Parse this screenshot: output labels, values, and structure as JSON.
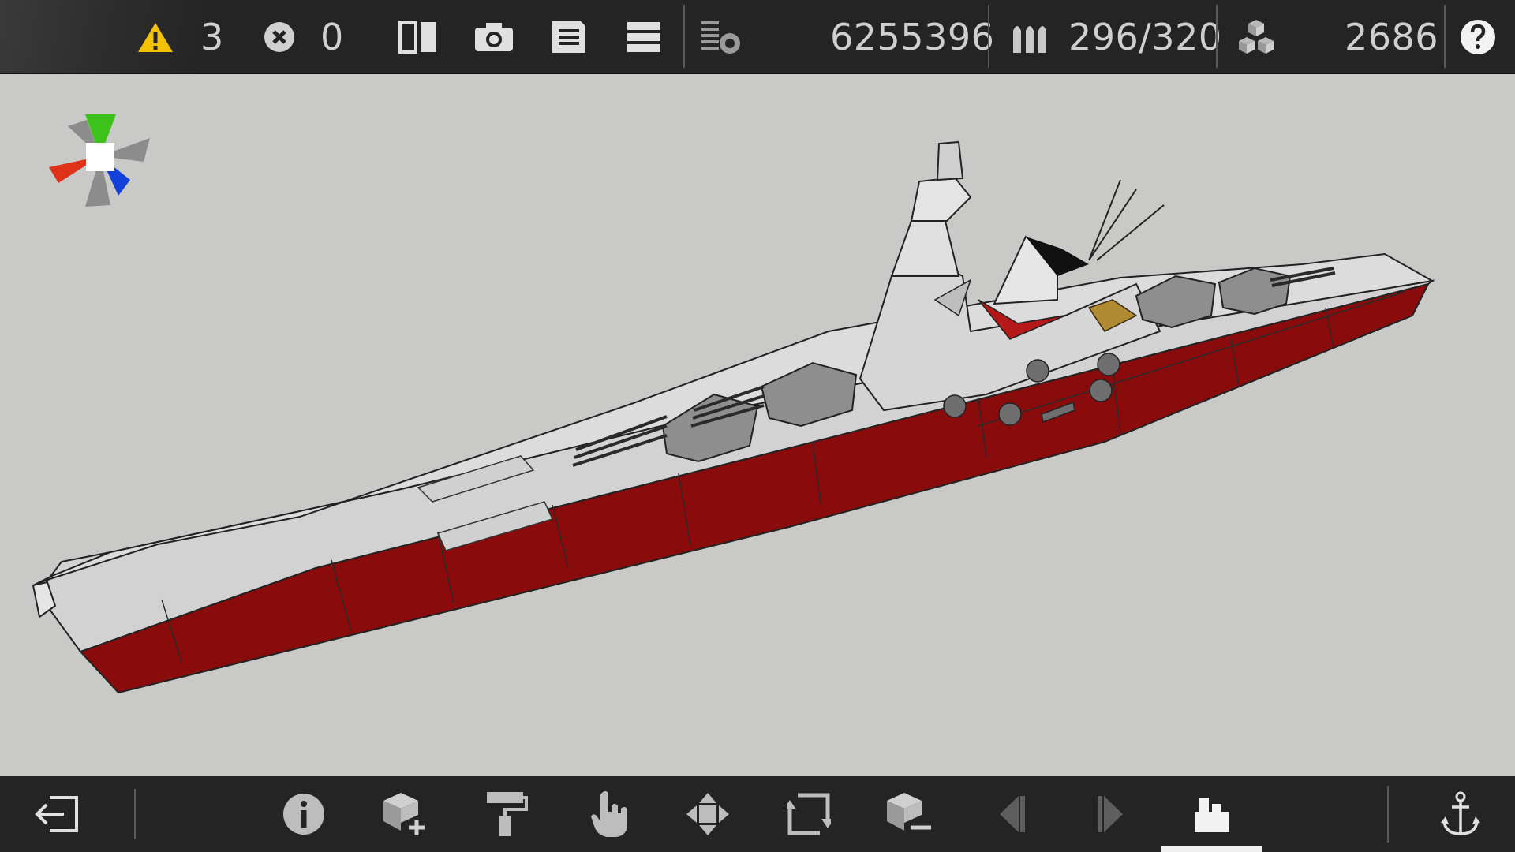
{
  "status": {
    "warnings": "3",
    "errors": "0",
    "points": "6255396",
    "ammo": "296/320",
    "blocks": "2686"
  },
  "icons": {
    "warning": "warning-triangle-icon",
    "error": "error-circle-x-icon",
    "mirror": "mirror-split-icon",
    "camera": "camera-icon",
    "save": "save-file-icon",
    "menu": "menu-list-icon",
    "layers": "layers-settings-icon",
    "ammo": "ammo-shells-icon",
    "blocks": "blocks-cubes-icon",
    "help": "help-icon"
  },
  "bottom_tools": [
    "exit-icon",
    "info-icon",
    "add-block-icon",
    "paint-roller-icon",
    "select-hand-icon",
    "move-arrows-icon",
    "rotate-frame-icon",
    "remove-block-icon",
    "undo-icon",
    "redo-icon",
    "build-mode-icon",
    "anchor-icon"
  ],
  "colors": {
    "toolbar_bg": "#242424",
    "viewport_bg": "#c9cac8",
    "warning_yellow": "#f2c200",
    "hull_red": "#8a0b0b",
    "deck_gray": "#d4d4d4",
    "axis_x": "#e03218",
    "axis_y": "#3cc21a",
    "axis_z": "#1240d8"
  }
}
